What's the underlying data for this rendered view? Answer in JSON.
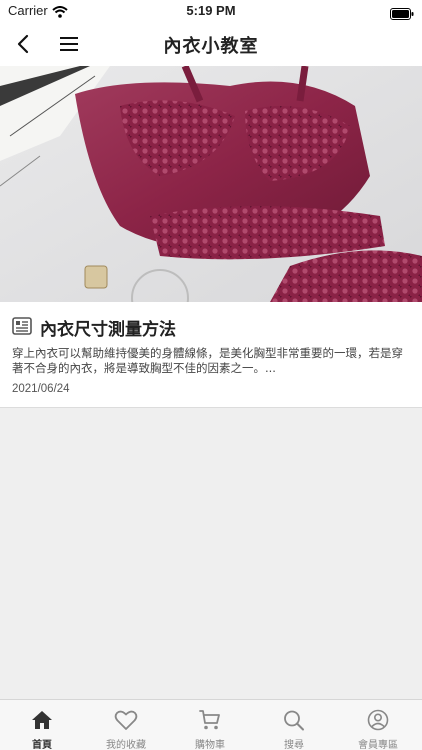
{
  "status_bar": {
    "carrier": "Carrier",
    "time": "5:19 PM"
  },
  "nav": {
    "title": "內衣小教室",
    "back_icon": "chevron-left-icon",
    "menu_icon": "hamburger-menu-icon"
  },
  "article": {
    "title": "內衣尺寸測量方法",
    "excerpt": "穿上內衣可以幫助維持優美的身體線條，是美化胸型非常重要的一環，若是穿著不合身的內衣，將是導致胸型不佳的因素之一。...",
    "date": "2021/06/24",
    "icon": "document-icon",
    "image_alt": "burgundy-lace-bra-photo"
  },
  "tabs": [
    {
      "label": "首頁",
      "icon": "home-icon",
      "active": true
    },
    {
      "label": "我的收藏",
      "icon": "heart-icon",
      "active": false
    },
    {
      "label": "購物車",
      "icon": "cart-icon",
      "active": false
    },
    {
      "label": "搜尋",
      "icon": "search-icon",
      "active": false
    },
    {
      "label": "會員專區",
      "icon": "user-circle-icon",
      "active": false
    }
  ],
  "colors": {
    "accent": "#8b2448",
    "tab_active": "#333333",
    "tab_inactive": "#888888",
    "background": "#efefef"
  }
}
